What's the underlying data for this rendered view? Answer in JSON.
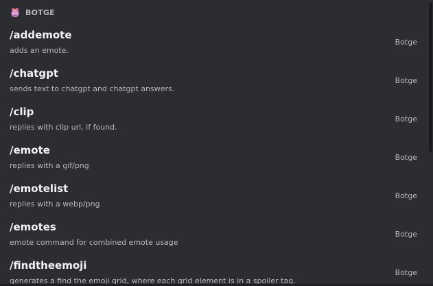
{
  "section": {
    "app_name": "BOTGE",
    "icon": "botge-avatar-icon"
  },
  "commands": [
    {
      "name": "/addemote",
      "description": "adds an emote.",
      "source": "Botge"
    },
    {
      "name": "/chatgpt",
      "description": "sends text to chatgpt and chatgpt answers.",
      "source": "Botge"
    },
    {
      "name": "/clip",
      "description": "replies with clip url, if found.",
      "source": "Botge"
    },
    {
      "name": "/emote",
      "description": "replies with a gif/png",
      "source": "Botge"
    },
    {
      "name": "/emotelist",
      "description": "replies with a webp/png",
      "source": "Botge"
    },
    {
      "name": "/emotes",
      "description": "emote command for combined emote usage",
      "source": "Botge"
    },
    {
      "name": "/findtheemoji",
      "description": "generates a find the emoji grid, where each grid element is in a spoiler tag.",
      "source": "Botge"
    }
  ],
  "colors": {
    "background": "#2b2d31",
    "command_name": "#f2f3f5",
    "muted_text": "#b5bac1",
    "scrollbar_thumb": "#1a1b1e"
  }
}
